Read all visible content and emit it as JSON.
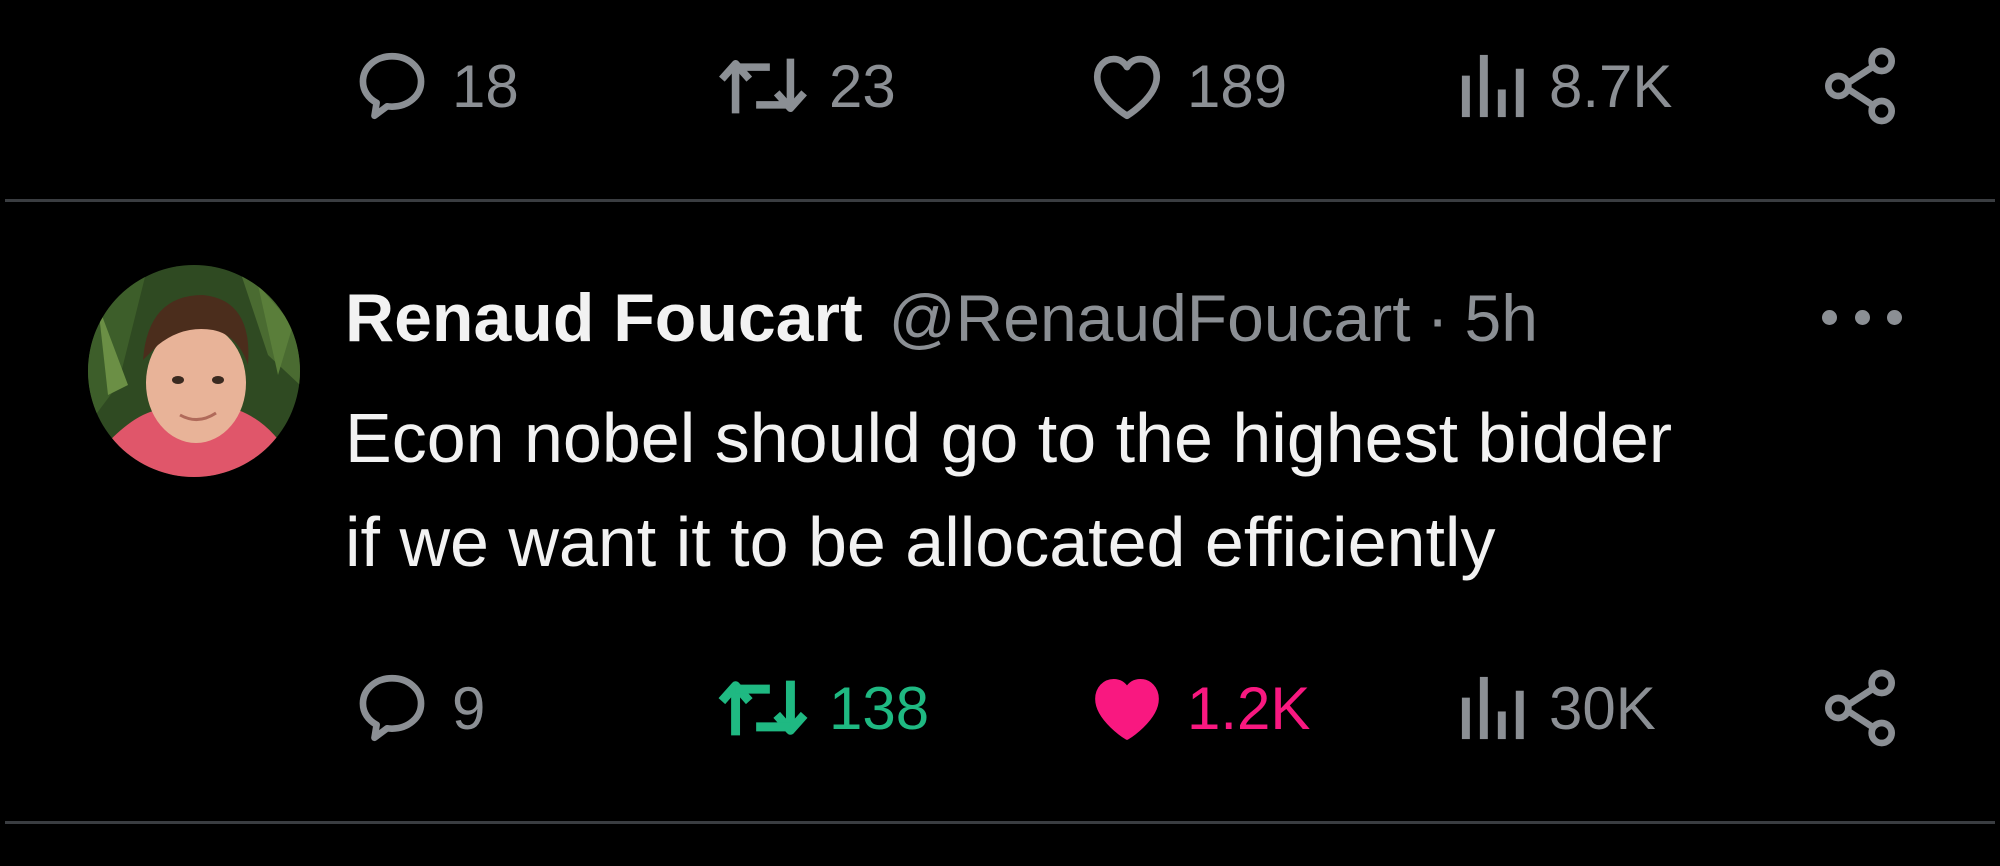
{
  "previous_tweet": {
    "actions": {
      "reply_count": "18",
      "retweet_count": "23",
      "like_count": "189",
      "views_count": "8.7K"
    }
  },
  "tweet": {
    "author": {
      "display_name": "Renaud Foucart",
      "handle": "@RenaudFoucart"
    },
    "separator": "·",
    "time": "5h",
    "text_lines": [
      "Econ nobel should go to the highest bidder",
      "if we want it to be allocated efficiently"
    ],
    "actions": {
      "reply_count": "9",
      "retweet_count": "138",
      "like_count": "1.2K",
      "views_count": "30K"
    },
    "state": {
      "retweeted": true,
      "liked": true
    }
  },
  "icons": {
    "reply": "reply-icon",
    "retweet": "retweet-icon",
    "like": "heart-icon",
    "views": "views-icon",
    "share": "share-icon",
    "more": "more-icon"
  },
  "colors": {
    "background": "#000000",
    "muted": "#8b8f94",
    "text": "#f2f2f2",
    "retweet_active": "#1fb982",
    "like_active": "#f91880",
    "divider": "#3a3d41"
  }
}
